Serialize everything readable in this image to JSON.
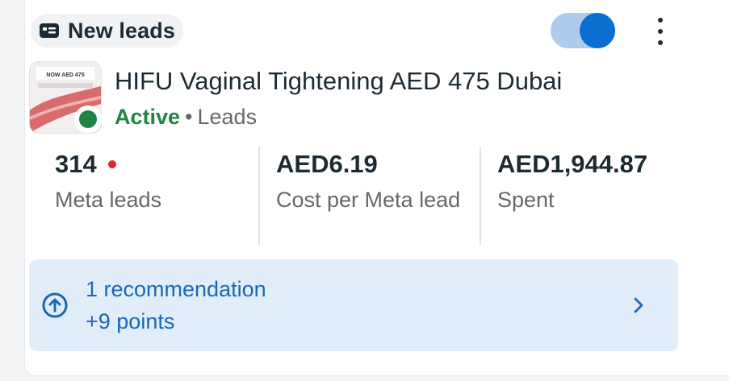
{
  "header": {
    "badge_label": "New leads",
    "badge_icon": "lead-form-icon",
    "toggle_on": true,
    "more_icon": "more-vertical-icon"
  },
  "campaign": {
    "title": "HIFU Vaginal Tightening AED 475 Dubai",
    "status": "Active",
    "separator": "•",
    "objective": "Leads",
    "status_color": "#1f8544",
    "thumbnail_text": "NOW AED 475"
  },
  "metrics": [
    {
      "value": "314",
      "label": "Meta leads"
    },
    {
      "value": "AED6.19",
      "label": "Cost per Meta lead"
    },
    {
      "value": "AED1,944.87",
      "label": "Spent"
    }
  ],
  "recommendation": {
    "title": "1 recommendation",
    "points": "+9 points",
    "icon": "arrow-up-circle-icon",
    "chevron": "chevron-right-icon"
  },
  "colors": {
    "accent": "#0a6fd1",
    "toggle_track": "#aecbee",
    "reco_bg": "#e1eef9",
    "reco_text": "#1a68b5",
    "alert_dot": "#e0262f"
  }
}
